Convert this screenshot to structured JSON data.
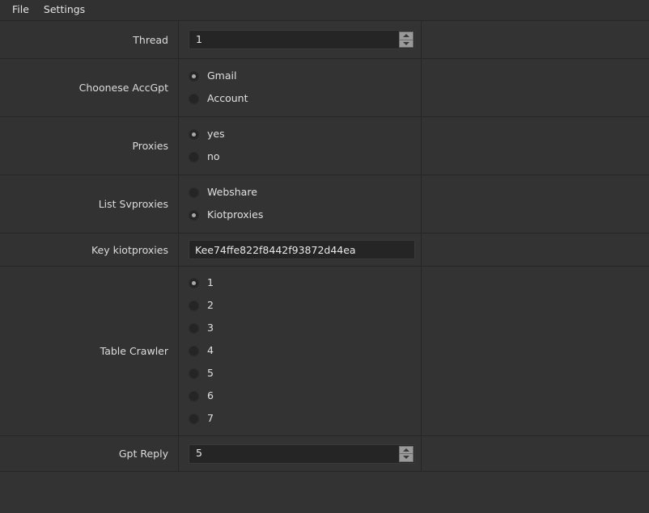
{
  "menu": {
    "items": [
      {
        "label": "File"
      },
      {
        "label": "Settings"
      }
    ]
  },
  "form": {
    "rows": [
      {
        "label": "Thread",
        "type": "spinner",
        "value": "1"
      },
      {
        "label": "Choonese AccGpt",
        "type": "radio",
        "options": [
          {
            "label": "Gmail",
            "selected": true
          },
          {
            "label": "Account",
            "selected": false
          }
        ]
      },
      {
        "label": "Proxies",
        "type": "radio",
        "options": [
          {
            "label": "yes",
            "selected": true
          },
          {
            "label": "no",
            "selected": false
          }
        ]
      },
      {
        "label": "List Svproxies",
        "type": "radio",
        "options": [
          {
            "label": "Webshare",
            "selected": false
          },
          {
            "label": "Kiotproxies",
            "selected": true
          }
        ]
      },
      {
        "label": "Key kiotproxies",
        "type": "text",
        "value": "Kee74ffe822f8442f93872d44ea",
        "placeholder": ""
      },
      {
        "label": "Table Crawler",
        "type": "radio",
        "options": [
          {
            "label": "1",
            "selected": true
          },
          {
            "label": "2",
            "selected": false
          },
          {
            "label": "3",
            "selected": false
          },
          {
            "label": "4",
            "selected": false
          },
          {
            "label": "5",
            "selected": false
          },
          {
            "label": "6",
            "selected": false
          },
          {
            "label": "7",
            "selected": false
          }
        ]
      },
      {
        "label": "Gpt Reply",
        "type": "spinner",
        "value": "5"
      }
    ]
  },
  "colors": {
    "window_background": "#313131",
    "row_background": "#333333",
    "grid_line": "#262626",
    "input_background": "#252525",
    "text": "#dcdcdc",
    "spinner_button": "#9a9a9a"
  }
}
